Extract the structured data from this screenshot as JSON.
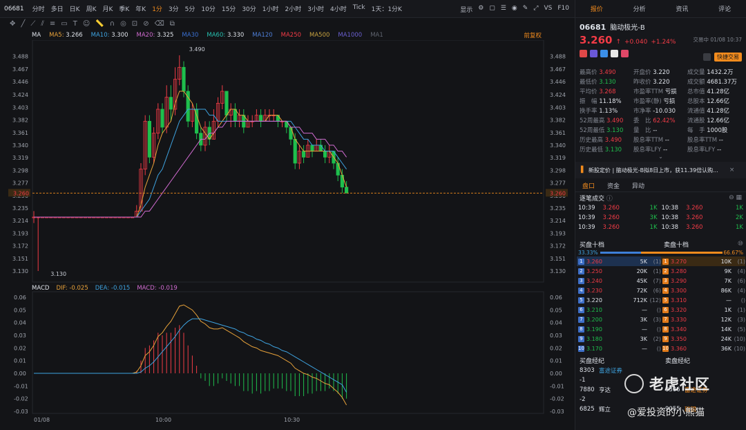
{
  "topbar": {
    "code": "06681",
    "periods": [
      "分时",
      "多日",
      "日K",
      "周K",
      "月K",
      "季K",
      "年K",
      "1分",
      "3分",
      "5分",
      "10分",
      "15分",
      "30分",
      "1小时",
      "2小时",
      "3小时",
      "4小时",
      "Tick",
      "1天：1分K"
    ],
    "active_period": "1分",
    "display_label": "显示",
    "vs_label": "VS",
    "f10_label": "F10"
  },
  "ma_bar": {
    "label": "MA",
    "items": [
      {
        "name": "MA5",
        "value": "3.266",
        "color": "#e8a23a"
      },
      {
        "name": "MA10",
        "value": "3.300",
        "color": "#3ea3e0"
      },
      {
        "name": "MA20",
        "value": "3.325",
        "color": "#d06bd0"
      },
      {
        "name": "MA30",
        "value": "",
        "color": "#3a6fd0"
      },
      {
        "name": "MA60",
        "value": "3.330",
        "color": "#26c0b0"
      },
      {
        "name": "MA120",
        "value": "",
        "color": "#4e7fd8"
      },
      {
        "name": "MA250",
        "value": "",
        "color": "#f23b46"
      },
      {
        "name": "MA500",
        "value": "",
        "color": "#c8a340"
      },
      {
        "name": "MA1000",
        "value": "",
        "color": "#6a5fd0"
      },
      {
        "name": "MA1",
        "value": "",
        "color": "#606570"
      }
    ],
    "adjust": "前复权"
  },
  "price_axis": {
    "ticks": [
      "3.488",
      "3.467",
      "3.446",
      "3.424",
      "3.403",
      "3.382",
      "3.361",
      "3.340",
      "3.319",
      "3.298",
      "3.277",
      "3.256",
      "3.235",
      "3.214",
      "3.193",
      "3.172",
      "3.151",
      "3.130"
    ],
    "current": "3.260",
    "high_label": "3.490",
    "low_label": "3.130"
  },
  "macd_bar": {
    "label": "MACD",
    "dif_label": "DIF:",
    "dif": "-0.025",
    "dea_label": "DEA:",
    "dea": "-0.015",
    "macd_label": "MACD:",
    "macd": "-0.019"
  },
  "macd_axis": [
    "0.06",
    "0.05",
    "0.04",
    "0.03",
    "0.02",
    "0.01",
    "0.00",
    "-0.01",
    "-0.02",
    "-0.03"
  ],
  "time_axis": [
    "01/08",
    "10:00",
    "10:30"
  ],
  "panel": {
    "tabs": [
      "报价",
      "分析",
      "资讯",
      "评论"
    ],
    "code": "06681",
    "name": "脑动极光-B",
    "price": "3.260",
    "change": "+0.040",
    "change_pct": "+1.24%",
    "time": "交易中 01/08 10:37",
    "quick_trade": "快捷交易",
    "stats": [
      [
        "最高价",
        "3.490",
        "开盘价",
        "3.220",
        "成交量",
        "1432.2万"
      ],
      [
        "最低价",
        "3.130",
        "昨收价",
        "3.220",
        "成交额",
        "4681.37万"
      ],
      [
        "平均价",
        "3.268",
        "市盈率TTM",
        "亏损",
        "总市值",
        "41.28亿"
      ],
      [
        "振　幅",
        "11.18%",
        "市盈率(静)",
        "亏损",
        "总股本",
        "12.66亿"
      ],
      [
        "换手率",
        "1.13%",
        "市净率",
        "-10.030",
        "流通值",
        "41.28亿"
      ],
      [
        "52周最高",
        "3.490",
        "委　比",
        "62.42%",
        "流通股",
        "12.66亿"
      ],
      [
        "52周最低",
        "3.130",
        "量　比",
        "--",
        "每　手",
        "1000股"
      ],
      [
        "历史最高",
        "3.490",
        "股息率TTM",
        "--",
        "股息率TTM",
        "--"
      ],
      [
        "历史最低",
        "3.130",
        "股息率LFY",
        "--",
        "股息率LFY",
        "--"
      ]
    ],
    "news": "新股定价 | 脑动极光-B拟8日上市，获11.39倍认购...",
    "sub_tabs": [
      "盘口",
      "资金",
      "异动"
    ],
    "ticks_title": "逐笔成交",
    "ticks": [
      [
        "10:39",
        "3.260",
        "1K",
        "10:38",
        "3.260",
        "1K"
      ],
      [
        "10:39",
        "3.260",
        "3K",
        "10:38",
        "3.260",
        "2K"
      ],
      [
        "10:39",
        "3.260",
        "1K",
        "10:38",
        "3.260",
        "1K"
      ]
    ],
    "bid_title": "买盘十档",
    "ask_title": "卖盘十档",
    "bid_pct": "33.33%",
    "ask_pct": "66.67%",
    "bids": [
      [
        "1",
        "3.260",
        "5K",
        "1"
      ],
      [
        "2",
        "3.250",
        "20K",
        "1"
      ],
      [
        "3",
        "3.240",
        "45K",
        "7"
      ],
      [
        "4",
        "3.230",
        "72K",
        "6"
      ],
      [
        "5",
        "3.220",
        "712K",
        "12"
      ],
      [
        "6",
        "3.210",
        "—",
        ""
      ],
      [
        "7",
        "3.200",
        "3K",
        "3"
      ],
      [
        "8",
        "3.190",
        "—",
        ""
      ],
      [
        "9",
        "3.180",
        "3K",
        "2"
      ],
      [
        "10",
        "3.170",
        "—",
        ""
      ]
    ],
    "asks": [
      [
        "1",
        "3.270",
        "10K",
        "1"
      ],
      [
        "2",
        "3.280",
        "9K",
        "4"
      ],
      [
        "3",
        "3.290",
        "7K",
        "6"
      ],
      [
        "4",
        "3.300",
        "86K",
        "4"
      ],
      [
        "5",
        "3.310",
        "—",
        ""
      ],
      [
        "6",
        "3.320",
        "1K",
        "1"
      ],
      [
        "7",
        "3.330",
        "12K",
        "3"
      ],
      [
        "8",
        "3.340",
        "14K",
        "5"
      ],
      [
        "9",
        "3.350",
        "24K",
        "10"
      ],
      [
        "10",
        "3.360",
        "36K",
        "10"
      ]
    ],
    "brokers_bid_title": "买盘经纪",
    "brokers_ask_title": "卖盘经纪",
    "brokers": [
      [
        "8303",
        "富途证券",
        "",
        ""
      ],
      [
        "-1",
        "",
        "",
        ""
      ],
      [
        "7880",
        "亨达",
        "8306",
        "富途证券"
      ],
      [
        "-2",
        "",
        "",
        ""
      ],
      [
        "6825",
        "辉立",
        "9055",
        "瑞银"
      ]
    ]
  },
  "watermark": {
    "line1": "老虎社区",
    "line2": "@爱投资的小熊猫"
  },
  "chart_data": {
    "type": "candlestick",
    "price_range": [
      3.13,
      3.49
    ],
    "macd_range": [
      -0.03,
      0.06
    ],
    "candles": [
      [
        3.22,
        3.22,
        3.23,
        3.21
      ],
      [
        3.22,
        3.22,
        3.22,
        3.13
      ],
      [
        3.22,
        3.22,
        3.22,
        3.22
      ],
      [
        3.22,
        3.22,
        3.22,
        3.22
      ],
      [
        3.22,
        3.22,
        3.22,
        3.22
      ],
      [
        3.22,
        3.22,
        3.22,
        3.22
      ],
      [
        3.22,
        3.22,
        3.22,
        3.22
      ],
      [
        3.22,
        3.22,
        3.22,
        3.22
      ],
      [
        3.22,
        3.22,
        3.22,
        3.22
      ],
      [
        3.22,
        3.22,
        3.22,
        3.22
      ],
      [
        3.22,
        3.22,
        3.22,
        3.22
      ],
      [
        3.22,
        3.22,
        3.22,
        3.22
      ],
      [
        3.22,
        3.22,
        3.22,
        3.22
      ],
      [
        3.22,
        3.22,
        3.22,
        3.22
      ],
      [
        3.22,
        3.22,
        3.22,
        3.22
      ],
      [
        3.22,
        3.22,
        3.22,
        3.22
      ],
      [
        3.22,
        3.22,
        3.22,
        3.22
      ],
      [
        3.22,
        3.22,
        3.22,
        3.22
      ],
      [
        3.22,
        3.22,
        3.22,
        3.22
      ],
      [
        3.22,
        3.22,
        3.22,
        3.22
      ],
      [
        3.22,
        3.22,
        3.22,
        3.22
      ],
      [
        3.22,
        3.22,
        3.22,
        3.22
      ],
      [
        3.22,
        3.22,
        3.22,
        3.22
      ],
      [
        3.22,
        3.22,
        3.22,
        3.22
      ],
      [
        3.22,
        3.23,
        3.24,
        3.22
      ],
      [
        3.23,
        3.3,
        3.31,
        3.23
      ],
      [
        3.3,
        3.38,
        3.39,
        3.29
      ],
      [
        3.38,
        3.32,
        3.39,
        3.31
      ],
      [
        3.32,
        3.36,
        3.37,
        3.31
      ],
      [
        3.36,
        3.4,
        3.41,
        3.35
      ],
      [
        3.4,
        3.37,
        3.41,
        3.36
      ],
      [
        3.37,
        3.42,
        3.44,
        3.36
      ],
      [
        3.42,
        3.4,
        3.44,
        3.38
      ],
      [
        3.4,
        3.45,
        3.47,
        3.39
      ],
      [
        3.45,
        3.47,
        3.49,
        3.44
      ],
      [
        3.47,
        3.43,
        3.48,
        3.42
      ],
      [
        3.43,
        3.38,
        3.44,
        3.37
      ],
      [
        3.38,
        3.4,
        3.41,
        3.37
      ],
      [
        3.4,
        3.36,
        3.41,
        3.35
      ],
      [
        3.36,
        3.34,
        3.37,
        3.33
      ],
      [
        3.34,
        3.37,
        3.38,
        3.33
      ],
      [
        3.37,
        3.35,
        3.38,
        3.34
      ],
      [
        3.35,
        3.38,
        3.4,
        3.35
      ],
      [
        3.38,
        3.41,
        3.42,
        3.37
      ],
      [
        3.41,
        3.43,
        3.44,
        3.4
      ],
      [
        3.43,
        3.39,
        3.43,
        3.38
      ],
      [
        3.39,
        3.4,
        3.41,
        3.37
      ],
      [
        3.4,
        3.38,
        3.41,
        3.37
      ],
      [
        3.38,
        3.39,
        3.4,
        3.37
      ],
      [
        3.39,
        3.37,
        3.4,
        3.36
      ],
      [
        3.37,
        3.38,
        3.39,
        3.37
      ],
      [
        3.38,
        3.38,
        3.39,
        3.37
      ],
      [
        3.38,
        3.39,
        3.4,
        3.38
      ],
      [
        3.39,
        3.38,
        3.4,
        3.37
      ],
      [
        3.38,
        3.39,
        3.4,
        3.38
      ],
      [
        3.39,
        3.39,
        3.4,
        3.38
      ],
      [
        3.39,
        3.39,
        3.4,
        3.38
      ],
      [
        3.39,
        3.38,
        3.39,
        3.37
      ],
      [
        3.38,
        3.38,
        3.38,
        3.37
      ],
      [
        3.38,
        3.37,
        3.38,
        3.36
      ],
      [
        3.37,
        3.35,
        3.37,
        3.34
      ],
      [
        3.35,
        3.31,
        3.36,
        3.3
      ],
      [
        3.31,
        3.33,
        3.34,
        3.3
      ],
      [
        3.33,
        3.32,
        3.34,
        3.31
      ],
      [
        3.32,
        3.34,
        3.35,
        3.32
      ],
      [
        3.34,
        3.33,
        3.34,
        3.32
      ],
      [
        3.33,
        3.34,
        3.35,
        3.33
      ],
      [
        3.34,
        3.33,
        3.35,
        3.33
      ],
      [
        3.33,
        3.32,
        3.34,
        3.31
      ],
      [
        3.32,
        3.33,
        3.34,
        3.31
      ],
      [
        3.33,
        3.31,
        3.33,
        3.3
      ],
      [
        3.31,
        3.29,
        3.32,
        3.28
      ],
      [
        3.29,
        3.27,
        3.3,
        3.26
      ],
      [
        3.27,
        3.26,
        3.28,
        3.26
      ]
    ],
    "ma5": [
      3.22,
      3.22,
      3.22,
      3.22,
      3.22,
      3.22,
      3.22,
      3.22,
      3.22,
      3.22,
      3.22,
      3.22,
      3.22,
      3.22,
      3.22,
      3.22,
      3.22,
      3.22,
      3.22,
      3.22,
      3.22,
      3.22,
      3.22,
      3.22,
      3.22,
      3.24,
      3.27,
      3.29,
      3.31,
      3.34,
      3.36,
      3.37,
      3.38,
      3.41,
      3.43,
      3.43,
      3.42,
      3.41,
      3.39,
      3.37,
      3.36,
      3.35,
      3.36,
      3.37,
      3.38,
      3.39,
      3.4,
      3.4,
      3.39,
      3.39,
      3.38,
      3.38,
      3.38,
      3.38,
      3.38,
      3.39,
      3.39,
      3.39,
      3.38,
      3.38,
      3.37,
      3.35,
      3.34,
      3.33,
      3.33,
      3.33,
      3.33,
      3.33,
      3.33,
      3.33,
      3.32,
      3.31,
      3.29,
      3.27
    ],
    "ma10": [
      3.22,
      3.22,
      3.22,
      3.22,
      3.22,
      3.22,
      3.22,
      3.22,
      3.22,
      3.22,
      3.22,
      3.22,
      3.22,
      3.22,
      3.22,
      3.22,
      3.22,
      3.22,
      3.22,
      3.22,
      3.22,
      3.22,
      3.22,
      3.22,
      3.22,
      3.23,
      3.24,
      3.25,
      3.27,
      3.29,
      3.3,
      3.32,
      3.34,
      3.36,
      3.38,
      3.39,
      3.4,
      3.4,
      3.4,
      3.4,
      3.4,
      3.39,
      3.39,
      3.38,
      3.38,
      3.38,
      3.38,
      3.38,
      3.38,
      3.38,
      3.38,
      3.38,
      3.38,
      3.38,
      3.38,
      3.38,
      3.38,
      3.38,
      3.38,
      3.38,
      3.38,
      3.37,
      3.36,
      3.35,
      3.35,
      3.34,
      3.34,
      3.34,
      3.33,
      3.33,
      3.33,
      3.32,
      3.31,
      3.3
    ],
    "ma20": [
      3.22,
      3.22,
      3.22,
      3.22,
      3.22,
      3.22,
      3.22,
      3.22,
      3.22,
      3.22,
      3.22,
      3.22,
      3.22,
      3.22,
      3.22,
      3.22,
      3.22,
      3.22,
      3.22,
      3.22,
      3.22,
      3.22,
      3.22,
      3.22,
      3.22,
      3.22,
      3.23,
      3.23,
      3.24,
      3.25,
      3.26,
      3.27,
      3.28,
      3.29,
      3.3,
      3.31,
      3.32,
      3.33,
      3.34,
      3.35,
      3.35,
      3.36,
      3.36,
      3.37,
      3.37,
      3.38,
      3.38,
      3.38,
      3.38,
      3.38,
      3.38,
      3.38,
      3.38,
      3.38,
      3.38,
      3.38,
      3.38,
      3.38,
      3.38,
      3.38,
      3.37,
      3.37,
      3.37,
      3.36,
      3.36,
      3.36,
      3.35,
      3.35,
      3.35,
      3.34,
      3.34,
      3.33,
      3.33,
      3.32
    ],
    "dif": [
      0,
      0,
      0,
      0,
      0,
      0,
      0,
      0,
      0,
      0,
      0,
      0,
      0,
      0,
      0,
      0,
      0,
      0,
      0,
      0,
      0,
      0,
      0,
      0,
      0.001,
      0.006,
      0.014,
      0.017,
      0.022,
      0.029,
      0.032,
      0.037,
      0.041,
      0.047,
      0.053,
      0.054,
      0.052,
      0.05,
      0.046,
      0.041,
      0.039,
      0.036,
      0.035,
      0.035,
      0.036,
      0.034,
      0.032,
      0.03,
      0.028,
      0.025,
      0.023,
      0.021,
      0.02,
      0.018,
      0.017,
      0.016,
      0.015,
      0.014,
      0.012,
      0.01,
      0.008,
      0.004,
      0.002,
      0.0,
      -0.001,
      -0.003,
      -0.004,
      -0.006,
      -0.008,
      -0.009,
      -0.012,
      -0.015,
      -0.019,
      -0.025
    ],
    "dea": [
      0,
      0,
      0,
      0,
      0,
      0,
      0,
      0,
      0,
      0,
      0,
      0,
      0,
      0,
      0,
      0,
      0,
      0,
      0,
      0,
      0,
      0,
      0,
      0,
      0,
      0.001,
      0.004,
      0.006,
      0.009,
      0.013,
      0.017,
      0.021,
      0.025,
      0.029,
      0.034,
      0.038,
      0.041,
      0.043,
      0.043,
      0.043,
      0.042,
      0.041,
      0.04,
      0.039,
      0.038,
      0.037,
      0.036,
      0.035,
      0.033,
      0.032,
      0.03,
      0.029,
      0.027,
      0.026,
      0.024,
      0.023,
      0.021,
      0.02,
      0.018,
      0.017,
      0.015,
      0.013,
      0.011,
      0.009,
      0.007,
      0.005,
      0.003,
      0.001,
      -0.001,
      -0.003,
      -0.005,
      -0.007,
      -0.009,
      -0.015
    ]
  }
}
